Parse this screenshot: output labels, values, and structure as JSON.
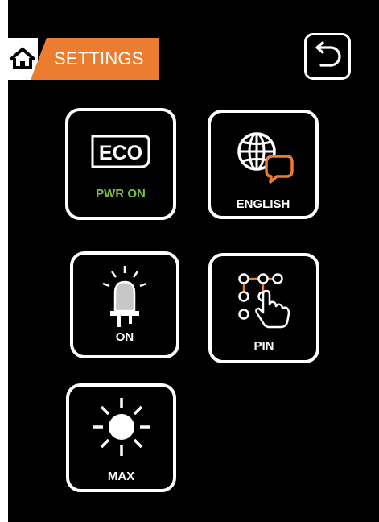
{
  "header": {
    "title": "SETTINGS",
    "home_icon": "home-icon",
    "back_icon": "back-arrow-icon"
  },
  "tiles": [
    {
      "name": "eco",
      "icon": "eco-icon",
      "icon_text": "ECO",
      "label": "PWR ON",
      "label_color": "#7fc241"
    },
    {
      "name": "language",
      "icon": "globe-chat-icon",
      "label": "ENGLISH"
    },
    {
      "name": "light",
      "icon": "lamp-icon",
      "label": "ON"
    },
    {
      "name": "pin",
      "icon": "pattern-lock-hand-icon",
      "label": "PIN"
    },
    {
      "name": "brightness",
      "icon": "sun-icon",
      "label": "MAX"
    }
  ],
  "colors": {
    "background": "#000000",
    "accent": "#ec7c30",
    "eco_status": "#7fc241",
    "foreground": "#ffffff"
  }
}
